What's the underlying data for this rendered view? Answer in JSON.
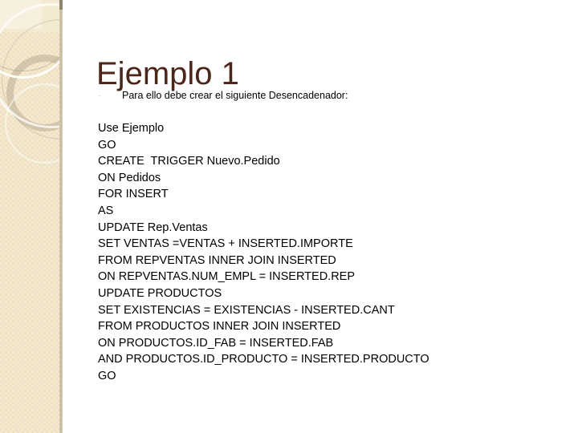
{
  "slide": {
    "title": "Ejemplo 1",
    "bullet": {
      "marker": "·",
      "text": "Para ello debe crear el siguiente Desencadenador:"
    },
    "code_lines": [
      "Use Ejemplo",
      "GO",
      "CREATE  TRIGGER Nuevo.Pedido",
      "ON Pedidos",
      "FOR INSERT",
      "AS",
      "UPDATE Rep.Ventas",
      "SET VENTAS =VENTAS + INSERTED.IMPORTE",
      "FROM REPVENTAS INNER JOIN INSERTED",
      "ON REPVENTAS.NUM_EMPL = INSERTED.REP",
      "UPDATE PRODUCTOS",
      "SET EXISTENCIAS = EXISTENCIAS - INSERTED.CANT",
      "FROM PRODUCTOS INNER JOIN INSERTED",
      "ON PRODUCTOS.ID_FAB = INSERTED.FAB",
      "AND PRODUCTOS.ID_PRODUCTO = INSERTED.PRODUCTO",
      "GO"
    ]
  },
  "colors": {
    "title": "#4B2619",
    "body_text": "#000000",
    "slide_background": "#FFFFFF",
    "sidebar_fill": "#EFE1C0",
    "sidebar_edge": "#C9C0A8",
    "decor_ring": "#A69A80"
  }
}
